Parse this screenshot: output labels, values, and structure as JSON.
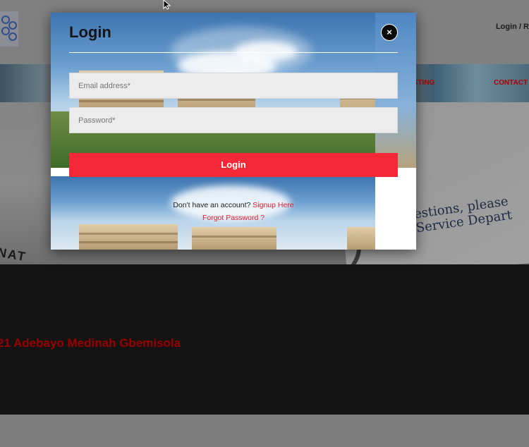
{
  "header": {
    "login_link": "Login / R",
    "nav_items": [
      "ISTING",
      "CONTACT"
    ]
  },
  "hero": {
    "text_line1": "estions, please",
    "text_line2": "Service Depart",
    "anat": "NAT"
  },
  "content": {
    "name_text": "21 Adebayo Medinah Gbemisola"
  },
  "modal": {
    "title": "Login",
    "close_label": "×",
    "email_placeholder": "Email address*",
    "password_placeholder": "Password*",
    "login_button": "Login",
    "signup_prompt": "Don't have an account?",
    "signup_link": "Signup Here",
    "forgot_link": "Forgot Password ?"
  },
  "colors": {
    "accent": "#f42837",
    "link": "#e0202e",
    "nav_red": "#b00000"
  },
  "icons": {
    "logo": "hospital-logo",
    "close": "close-icon",
    "cursor": "mouse-pointer-icon"
  }
}
